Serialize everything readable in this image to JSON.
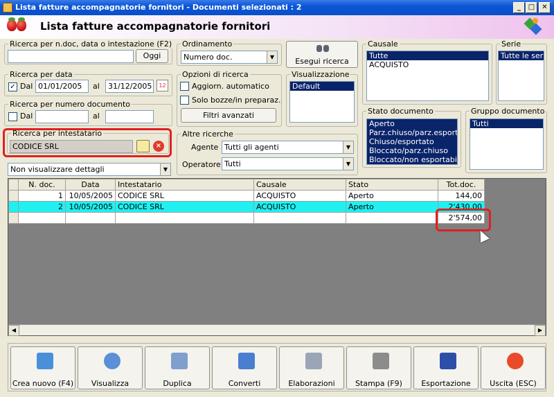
{
  "window": {
    "title": "Lista fatture accompagnatorie fornitori - Documenti selezionati : 2",
    "minimize": "_",
    "maximize": "□",
    "close": "✕"
  },
  "header": {
    "title": "Lista fatture accompagnatorie fornitori"
  },
  "search_ndoc": {
    "legend": "Ricerca per n.doc, data o intestazione (F2)",
    "value": "",
    "button": "Oggi"
  },
  "search_date": {
    "legend": "Ricerca per data",
    "checked": "✓",
    "dal_label": "Dal",
    "dal_value": "01/01/2005",
    "al_label": "al",
    "al_value": "31/12/2005",
    "calendar_label": "12"
  },
  "search_number": {
    "legend": "Ricerca per numero documento",
    "dal_label": "Dal",
    "dal_value": "",
    "al_label": "al",
    "al_value": ""
  },
  "search_holder": {
    "legend": "Ricerca per intestatario",
    "value": "CODICE SRL"
  },
  "details": {
    "value": "Non visualizzare dettagli"
  },
  "ordering": {
    "legend": "Ordinamento",
    "value": "Numero doc."
  },
  "options": {
    "legend": "Opzioni di ricerca",
    "auto_update": "Aggiorn. automatico",
    "drafts_only": "Solo bozze/in preparaz.",
    "advanced": "Filtri avanzati"
  },
  "other": {
    "legend": "Altre ricerche",
    "agent_label": "Agente :",
    "agent_value": "Tutti gli agenti",
    "operator_label": "Operatore :",
    "operator_value": "Tutti"
  },
  "execute": {
    "label": "Esegui ricerca"
  },
  "view": {
    "legend": "Visualizzazione",
    "items": [
      "Default"
    ]
  },
  "causale": {
    "legend": "Causale",
    "items": [
      "Tutte",
      "ACQUISTO"
    ]
  },
  "serie": {
    "legend": "Serie",
    "items": [
      "Tutte le serie"
    ]
  },
  "doc_state": {
    "legend": "Stato documento",
    "items": [
      "Aperto",
      "Parz.chiuso/parz.esportato",
      "Chiuso/esportato",
      "Bloccato/parz.chiuso",
      "Bloccato/non esportabile"
    ]
  },
  "doc_group": {
    "legend": "Gruppo documento",
    "items": [
      "Tutti"
    ]
  },
  "grid": {
    "headers": [
      "N. doc.",
      "Data",
      "Intestatario",
      "Causale",
      "Stato",
      "Tot.doc."
    ],
    "rows": [
      [
        "1",
        "10/05/2005",
        "CODICE SRL",
        "ACQUISTO",
        "Aperto",
        "144,00"
      ],
      [
        "2",
        "10/05/2005",
        "CODICE SRL",
        "ACQUISTO",
        "Aperto",
        "2'430,00"
      ]
    ],
    "total": "2'574,00"
  },
  "toolbar": [
    {
      "label": "Crea nuovo (F4)",
      "icon": "new-folder-icon",
      "color": "#4a90d9"
    },
    {
      "label": "Visualizza",
      "icon": "view-magnifier-icon",
      "color": "#5b8fd6"
    },
    {
      "label": "Duplica",
      "icon": "duplicate-icon",
      "color": "#7f9fcc"
    },
    {
      "label": "Converti",
      "icon": "convert-icon",
      "color": "#4a7fd0"
    },
    {
      "label": "Elaborazioni",
      "icon": "process-gear-icon",
      "color": "#9aa6b8"
    },
    {
      "label": "Stampa (F9)",
      "icon": "printer-icon",
      "color": "#8c8c8c"
    },
    {
      "label": "Esportazione",
      "icon": "save-disk-icon",
      "color": "#2d4fa8"
    },
    {
      "label": "Uscita (ESC)",
      "icon": "exit-icon",
      "color": "#e84a2a"
    }
  ]
}
